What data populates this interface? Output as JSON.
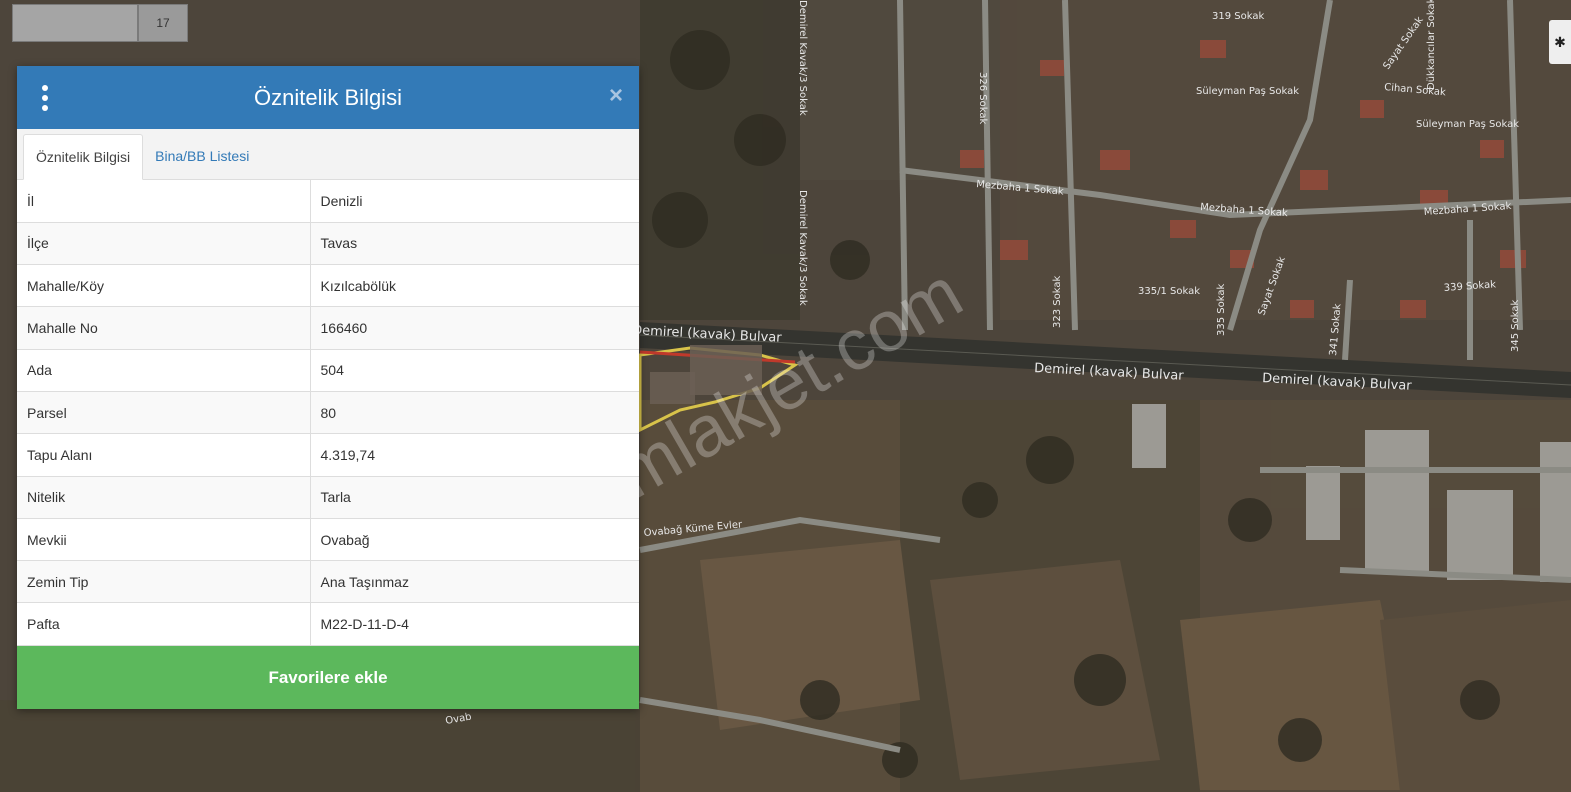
{
  "map": {
    "watermark": "emlakjet.com",
    "roads": {
      "boulevard_left": "Demirel (kavak) Bulvar",
      "boulevard_mid": "Demirel (kavak) Bulvar",
      "boulevard_right": "Demirel (kavak) Bulvar",
      "street_319": "319 Sokak",
      "street_sayat": "Sayat Sokak",
      "street_suleyman_1": "Süleyman Paş Sokak",
      "street_cihan": "Cihan Sokak",
      "street_suleyman_2": "Süleyman Paş Sokak",
      "street_mezbaha_1": "Mezbaha 1 Sokak",
      "street_mezbaha_2": "Mezbaha 1 Sokak",
      "street_mezbaha_3": "Mezbaha 1 Sokak",
      "street_326": "326 Sokak",
      "street_demirel_kavak3_a": "Demirel Kavak/3 Sokak",
      "street_demirel_kavak3_b": "Demirel Kavak/3 Sokak",
      "street_335_1": "335/1 Sokak",
      "street_339": "339 Sokak",
      "street_323": "323 Sokak",
      "street_335": "335 Sokak",
      "street_sayat_2": "Sayat Sokak",
      "street_341": "341 Sokak",
      "street_345": "345 Sokak",
      "street_dukkancilar": "Dükkancılar Sokak",
      "street_ovabag": "Ovabağ Küme Evler",
      "street_ovab_partial": "Ovab"
    },
    "colors": {
      "parcel_outline": "#d8c34a",
      "parcel_edge": "#c0392b"
    }
  },
  "topbar": {
    "badge_text": "17"
  },
  "panel": {
    "title": "Öznitelik Bilgisi",
    "close_icon": "×",
    "tabs": [
      {
        "label": "Öznitelik Bilgisi",
        "active": true
      },
      {
        "label": "Bina/BB Listesi",
        "active": false
      }
    ],
    "rows": [
      {
        "key": "İl",
        "value": "Denizli"
      },
      {
        "key": "İlçe",
        "value": "Tavas"
      },
      {
        "key": "Mahalle/Köy",
        "value": "Kızılcabölük"
      },
      {
        "key": "Mahalle No",
        "value": "166460"
      },
      {
        "key": "Ada",
        "value": "504"
      },
      {
        "key": "Parsel",
        "value": "80"
      },
      {
        "key": "Tapu Alanı",
        "value": "4.319,74"
      },
      {
        "key": "Nitelik",
        "value": "Tarla"
      },
      {
        "key": "Mevkii",
        "value": "Ovabağ"
      },
      {
        "key": "Zemin Tip",
        "value": "Ana Taşınmaz"
      },
      {
        "key": "Pafta",
        "value": "M22-D-11-D-4"
      }
    ],
    "favorite_button": "Favorilere ekle",
    "colors": {
      "header": "#337ab7",
      "button": "#5cb85c",
      "tab_link": "#337ab7"
    }
  }
}
